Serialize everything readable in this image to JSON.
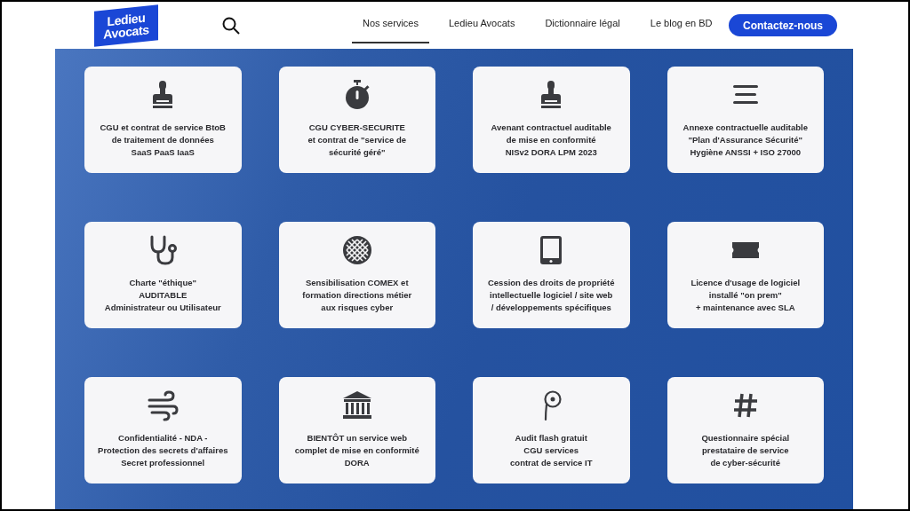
{
  "header": {
    "logo": [
      "Ledieu",
      "Avocats"
    ],
    "nav": [
      {
        "label": "Nos services",
        "selected": true
      },
      {
        "label": "Ledieu Avocats",
        "selected": false
      },
      {
        "label": "Dictionnaire légal",
        "selected": false
      },
      {
        "label": "Le blog en BD",
        "selected": false
      }
    ],
    "cta": "Contactez-nous"
  },
  "services": [
    {
      "kind": "stamp",
      "lines": [
        "CGU et contrat de service BtoB",
        "de traitement de données",
        "SaaS PaaS IaaS"
      ]
    },
    {
      "kind": "stopwatch",
      "lines": [
        "CGU CYBER-SECURITE",
        "et contrat de \"service de",
        "sécurité géré\""
      ]
    },
    {
      "kind": "stamp",
      "lines": [
        "Avenant contractuel auditable",
        "de mise en conformité",
        "NISv2 DORA LPM 2023"
      ]
    },
    {
      "kind": "lines",
      "lines": [
        "Annexe contractuelle auditable",
        "\"Plan d'Assurance Sécurité\"",
        "Hygiène ANSSI + ISO 27000"
      ]
    },
    {
      "kind": "stethoscope",
      "lines": [
        "Charte \"éthique\"",
        "AUDITABLE",
        "Administrateur ou Utilisateur"
      ]
    },
    {
      "kind": "globe",
      "lines": [
        "Sensibilisation COMEX et",
        "formation directions métier",
        "aux risques cyber"
      ]
    },
    {
      "kind": "tablet",
      "lines": [
        "Cession des droits de propriété",
        "intellectuelle logiciel / site web",
        "/ développements spécifiques"
      ]
    },
    {
      "kind": "ticket",
      "lines": [
        "Licence d'usage de logiciel",
        "installé \"on prem\"",
        "+ maintenance avec SLA"
      ]
    },
    {
      "kind": "wind",
      "lines": [
        "Confidentialité - NDA -",
        "Protection des secrets d'affaires",
        "Secret professionnel"
      ]
    },
    {
      "kind": "bank",
      "lines": [
        "BIENTÔT un service web",
        "complet de mise en conformité",
        "DORA"
      ]
    },
    {
      "kind": "pin",
      "lines": [
        "Audit flash gratuit",
        "CGU services",
        "contrat de service IT"
      ]
    },
    {
      "kind": "hash",
      "lines": [
        "Questionnaire spécial",
        "prestataire de service",
        "de cyber-sécurité"
      ]
    }
  ]
}
